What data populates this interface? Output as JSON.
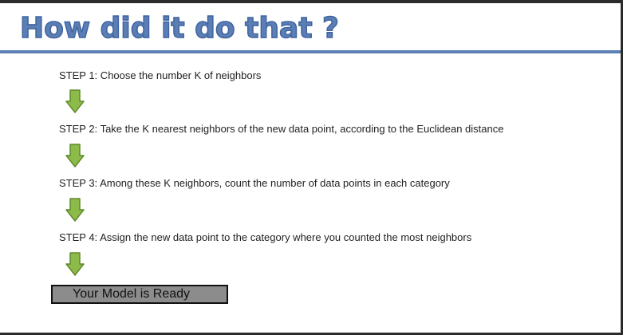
{
  "title": "How did it do that ?",
  "steps": [
    {
      "label": "STEP 1:",
      "text": " Choose the number K of neighbors"
    },
    {
      "label": "STEP 2:",
      "text": " Take the K nearest neighbors of the new data point, according to the Euclidean distance"
    },
    {
      "label": "STEP 3:",
      "text": " Among these K neighbors, count the number of data points in each category"
    },
    {
      "label": "STEP 4:",
      "text": " Assign the new data point to the category where you counted the most neighbors"
    }
  ],
  "result": "Your Model is Ready",
  "colors": {
    "title": "#5b7fb5",
    "rule": "#5b80b6",
    "arrow_fill": "#8dbb4a",
    "arrow_stroke": "#5e8a2a",
    "result_box": "#8c8c8c"
  },
  "icons": [
    "arrow-down-icon"
  ]
}
